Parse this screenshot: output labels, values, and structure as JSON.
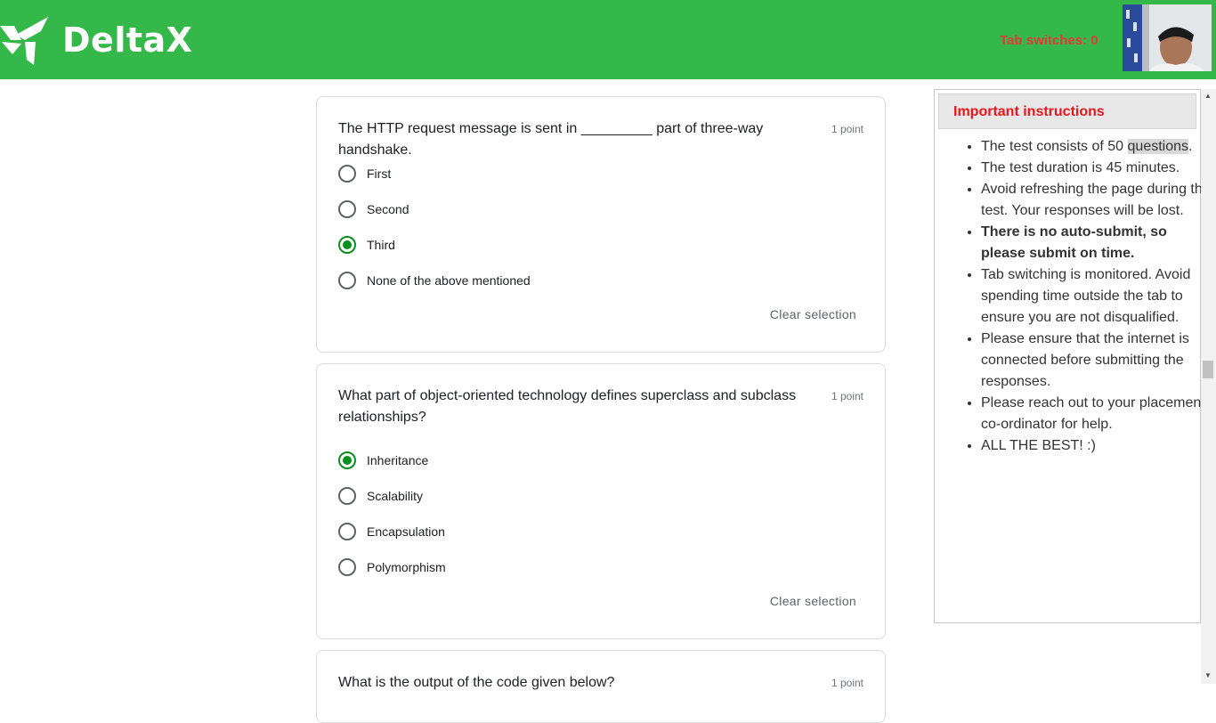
{
  "header": {
    "brand": "DeltaX",
    "tab_switches": "Tab switches: 0",
    "colors": {
      "header_bg": "#34b84a",
      "alert": "#e53935"
    }
  },
  "questions": [
    {
      "text": "The HTTP request message is sent in _________ part of three-way handshake.",
      "points": "1 point",
      "options": [
        "First",
        "Second",
        "Third",
        "None of the above mentioned"
      ],
      "selected_index": 2,
      "clear_label": "Clear selection"
    },
    {
      "text": "What part of object-oriented technology defines superclass and subclass relationships?",
      "points": "1 point",
      "options": [
        "Inheritance",
        "Scalability",
        "Encapsulation",
        "Polymorphism"
      ],
      "selected_index": 0,
      "clear_label": "Clear selection"
    },
    {
      "text": "What is the output of the code given below?",
      "points": "1 point"
    }
  ],
  "instructions": {
    "title": "Important instructions",
    "items": {
      "i1_a": "The test consists of 50 ",
      "i1_b": "questions",
      "i1_c": ".",
      "i2": "The test duration is 45 minutes.",
      "i3": "Avoid refreshing the page during the test. Your responses will be lost.",
      "i4": "There is no auto-submit, so please submit on time.",
      "i5": "Tab switching is monitored. Avoid spending time outside the tab to ensure you are not disqualified.",
      "i6": "Please ensure that the internet is connected before submitting the responses.",
      "i7": "Please reach out to your placement co-ordinator for help.",
      "i8": "ALL THE BEST! :)"
    }
  },
  "icons": {
    "logo": "deltax-logo-icon",
    "webcam": "webcam-feed",
    "scroll_up": "scroll-up-arrow-icon",
    "scroll_down": "scroll-down-arrow-icon"
  }
}
